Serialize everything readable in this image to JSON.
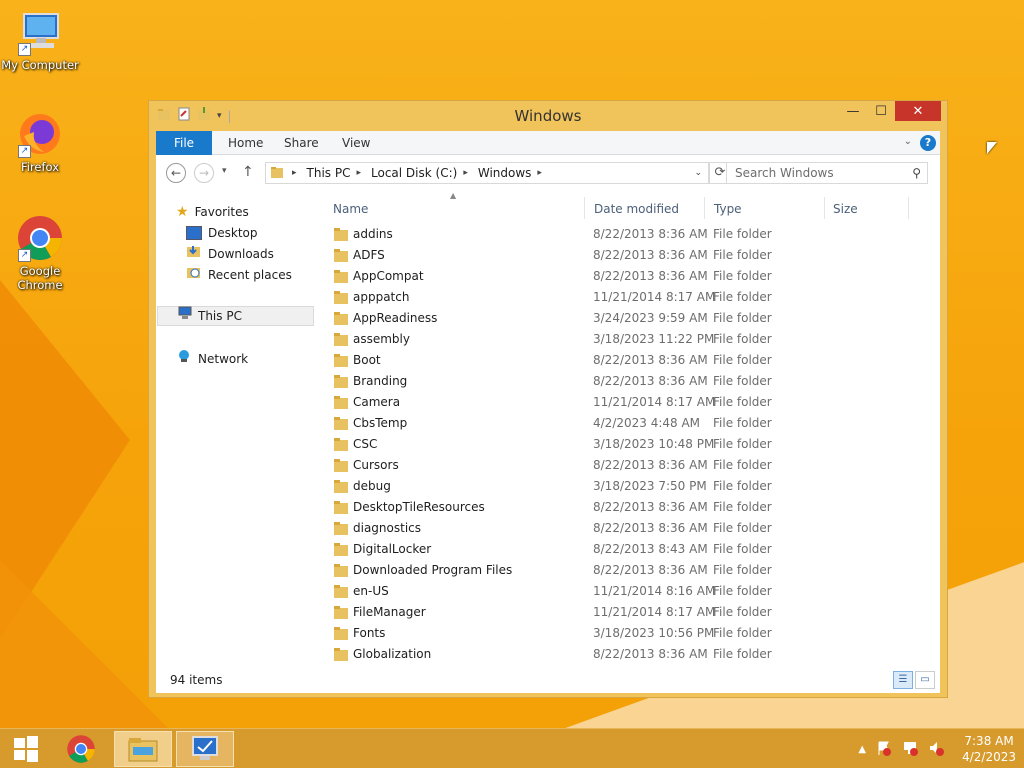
{
  "desktop": {
    "icons": [
      {
        "label": "My Computer"
      },
      {
        "label": "Firefox"
      },
      {
        "label": "Google Chrome"
      }
    ]
  },
  "window": {
    "title": "Windows",
    "controls": {
      "minimize": "—",
      "maximize": "☐",
      "close": "✕"
    }
  },
  "ribbon": {
    "tabs": [
      "File",
      "Home",
      "Share",
      "View"
    ]
  },
  "address": {
    "segments": [
      "This PC",
      "Local Disk (C:)",
      "Windows"
    ],
    "search_placeholder": "Search Windows"
  },
  "nav": {
    "favorites": "Favorites",
    "desktop": "Desktop",
    "downloads": "Downloads",
    "recent": "Recent places",
    "thispc": "This PC",
    "network": "Network"
  },
  "columns": {
    "name": "Name",
    "date": "Date modified",
    "type": "Type",
    "size": "Size"
  },
  "files": [
    {
      "name": "addins",
      "date": "8/22/2013 8:36 AM",
      "type": "File folder"
    },
    {
      "name": "ADFS",
      "date": "8/22/2013 8:36 AM",
      "type": "File folder"
    },
    {
      "name": "AppCompat",
      "date": "8/22/2013 8:36 AM",
      "type": "File folder"
    },
    {
      "name": "apppatch",
      "date": "11/21/2014 8:17 AM",
      "type": "File folder"
    },
    {
      "name": "AppReadiness",
      "date": "3/24/2023 9:59 AM",
      "type": "File folder"
    },
    {
      "name": "assembly",
      "date": "3/18/2023 11:22 PM",
      "type": "File folder"
    },
    {
      "name": "Boot",
      "date": "8/22/2013 8:36 AM",
      "type": "File folder"
    },
    {
      "name": "Branding",
      "date": "8/22/2013 8:36 AM",
      "type": "File folder"
    },
    {
      "name": "Camera",
      "date": "11/21/2014 8:17 AM",
      "type": "File folder"
    },
    {
      "name": "CbsTemp",
      "date": "4/2/2023 4:48 AM",
      "type": "File folder"
    },
    {
      "name": "CSC",
      "date": "3/18/2023 10:48 PM",
      "type": "File folder"
    },
    {
      "name": "Cursors",
      "date": "8/22/2013 8:36 AM",
      "type": "File folder"
    },
    {
      "name": "debug",
      "date": "3/18/2023 7:50 PM",
      "type": "File folder"
    },
    {
      "name": "DesktopTileResources",
      "date": "8/22/2013 8:36 AM",
      "type": "File folder"
    },
    {
      "name": "diagnostics",
      "date": "8/22/2013 8:36 AM",
      "type": "File folder"
    },
    {
      "name": "DigitalLocker",
      "date": "8/22/2013 8:43 AM",
      "type": "File folder"
    },
    {
      "name": "Downloaded Program Files",
      "date": "8/22/2013 8:36 AM",
      "type": "File folder"
    },
    {
      "name": "en-US",
      "date": "11/21/2014 8:16 AM",
      "type": "File folder"
    },
    {
      "name": "FileManager",
      "date": "11/21/2014 8:17 AM",
      "type": "File folder"
    },
    {
      "name": "Fonts",
      "date": "3/18/2023 10:56 PM",
      "type": "File folder"
    },
    {
      "name": "Globalization",
      "date": "8/22/2013 8:36 AM",
      "type": "File folder"
    }
  ],
  "status": {
    "count": "94 items"
  },
  "taskbar": {
    "clock_time": "7:38 AM",
    "clock_date": "4/2/2023"
  },
  "colors": {
    "accent": "#1979ca",
    "close": "#c7342a",
    "frame": "#f1c35b",
    "taskbar": "#d79a2c"
  }
}
